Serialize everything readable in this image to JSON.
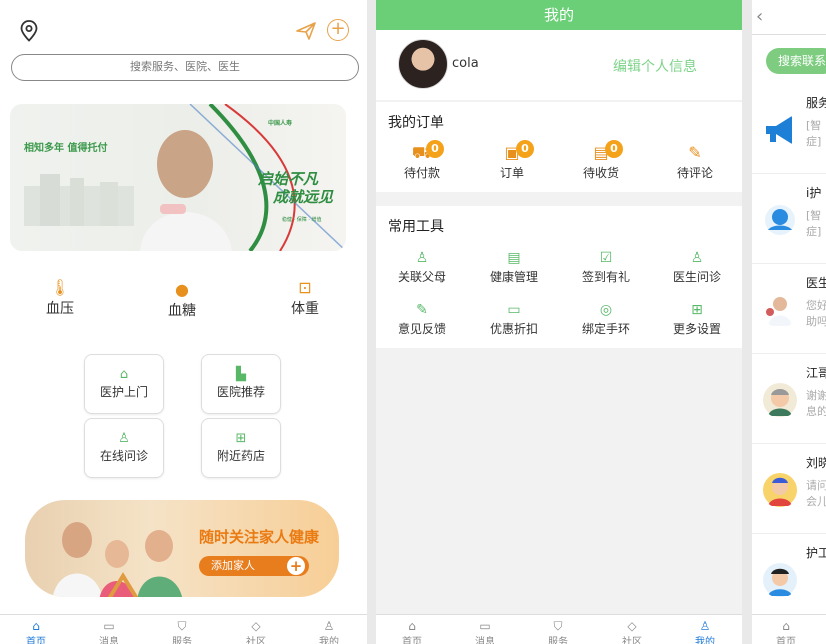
{
  "home": {
    "search_placeholder": "搜索服务、医院、医生",
    "banner1": {
      "headline": "相知多年 值得托付",
      "slogan_line1": "启始不凡",
      "slogan_line2": "成就远见",
      "tags": "稳健 · 保障 · 增值",
      "brand": "中国人寿"
    },
    "metrics": [
      {
        "label": "血压",
        "icon": "thermometer-icon"
      },
      {
        "label": "血糖",
        "icon": "drop-icon"
      },
      {
        "label": "体重",
        "icon": "scale-icon"
      }
    ],
    "services": [
      {
        "label": "医护上门",
        "icon": "home-icon"
      },
      {
        "label": "医院推荐",
        "icon": "hospital-icon"
      },
      {
        "label": "在线问诊",
        "icon": "doctor-icon"
      },
      {
        "label": "附近药店",
        "icon": "pharmacy-icon"
      }
    ],
    "banner2": {
      "title": "随时关注家人健康",
      "button": "添加家人"
    },
    "tabs": [
      {
        "label": "首页",
        "icon": "home-icon",
        "active": true
      },
      {
        "label": "消息",
        "icon": "message-icon",
        "active": false
      },
      {
        "label": "服务",
        "icon": "shield-icon",
        "active": false
      },
      {
        "label": "社区",
        "icon": "leaf-icon",
        "active": false
      },
      {
        "label": "我的",
        "icon": "user-icon",
        "active": false
      }
    ]
  },
  "mine": {
    "header_title": "我的",
    "username": "cola",
    "edit_profile": "编辑个人信息",
    "orders": {
      "title": "我的订单",
      "items": [
        {
          "label": "待付款",
          "badge": "0",
          "icon": "truck-icon"
        },
        {
          "label": "订单",
          "badge": "0",
          "icon": "wallet-icon"
        },
        {
          "label": "待收货",
          "badge": "0",
          "icon": "box-icon"
        },
        {
          "label": "待评论",
          "badge": "",
          "icon": "edit-icon"
        }
      ]
    },
    "tools": {
      "title": "常用工具",
      "items": [
        {
          "label": "关联父母",
          "icon": "parents-icon"
        },
        {
          "label": "健康管理",
          "icon": "clipboard-icon"
        },
        {
          "label": "签到有礼",
          "icon": "calendar-icon"
        },
        {
          "label": "医生问诊",
          "icon": "doctor-icon"
        },
        {
          "label": "意见反馈",
          "icon": "pen-icon"
        },
        {
          "label": "优惠折扣",
          "icon": "coupon-icon"
        },
        {
          "label": "绑定手环",
          "icon": "band-icon"
        },
        {
          "label": "更多设置",
          "icon": "grid-icon"
        }
      ]
    },
    "tabs": [
      {
        "label": "首页",
        "icon": "home-icon",
        "active": false
      },
      {
        "label": "消息",
        "icon": "message-icon",
        "active": false
      },
      {
        "label": "服务",
        "icon": "shield-icon",
        "active": false
      },
      {
        "label": "社区",
        "icon": "leaf-icon",
        "active": false
      },
      {
        "label": "我的",
        "icon": "user-icon",
        "active": true
      }
    ]
  },
  "messages": {
    "search_label": "搜索联系",
    "items": [
      {
        "title": "服务",
        "snippet1": "[智",
        "snippet2": "症]",
        "icon": "megaphone-icon"
      },
      {
        "title": "i护",
        "snippet1": "[智",
        "snippet2": "症]",
        "icon": "nurse-icon"
      },
      {
        "title": "医生",
        "snippet1": "您好",
        "snippet2": "助吗",
        "icon": "doctor-avatar-icon"
      },
      {
        "title": "江哥",
        "snippet1": "谢谢",
        "snippet2": "息的",
        "icon": "elder-avatar-icon"
      },
      {
        "title": "刘晓",
        "snippet1": "请问",
        "snippet2": "会儿",
        "icon": "child-avatar-icon"
      },
      {
        "title": "护工",
        "snippet1": "",
        "snippet2": "",
        "icon": "nurse-avatar-icon"
      }
    ],
    "tab": {
      "label": "首页",
      "icon": "home-icon"
    }
  },
  "colors": {
    "accent_green": "#6bcf78",
    "accent_orange": "#e8901e",
    "active_blue": "#1f7ad8"
  }
}
